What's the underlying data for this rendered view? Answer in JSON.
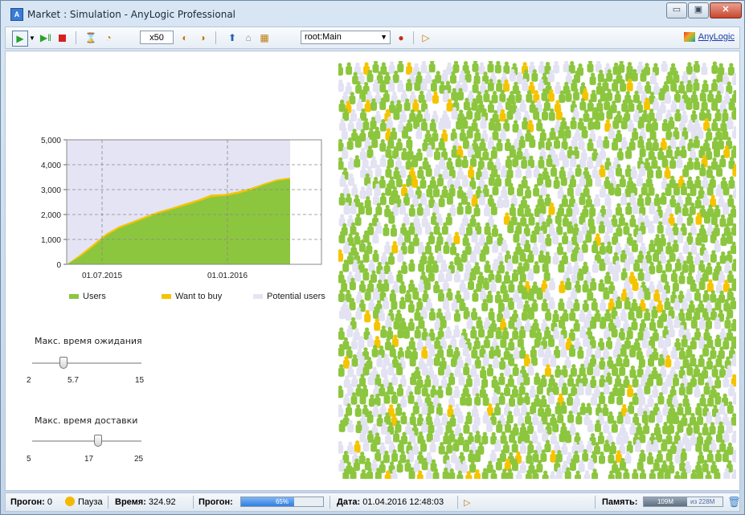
{
  "window": {
    "title": "Market : Simulation - AnyLogic Professional",
    "app_icon": "A",
    "controls": [
      "▭",
      "▣",
      "✕"
    ]
  },
  "toolbar": {
    "speed": "x50",
    "view_select": "root:Main",
    "brand": "AnyLogic"
  },
  "chart_data": {
    "type": "area",
    "x_ticks": [
      "01.07.2015",
      "01.01.2016"
    ],
    "y_ticks": [
      "5,000",
      "4,000",
      "3,000",
      "2,000",
      "1,000",
      "0"
    ],
    "ylim": [
      0,
      5000
    ],
    "grid": true,
    "legend_placement": "bottom",
    "series": [
      {
        "name": "Users",
        "color": "#8cc63f",
        "values": [
          0,
          300,
          700,
          1150,
          1450,
          1650,
          1850,
          2050,
          2200,
          2350,
          2520,
          2700,
          2740,
          2830,
          2980,
          3180,
          3350,
          3420
        ]
      },
      {
        "name": "Want to buy",
        "color": "#f5c400",
        "values": [
          0,
          380,
          800,
          1230,
          1530,
          1720,
          1930,
          2120,
          2270,
          2440,
          2600,
          2800,
          2820,
          2920,
          3060,
          3240,
          3410,
          3480
        ]
      },
      {
        "name": "Potential users",
        "color": "#e4e4f4",
        "values": [
          5000,
          5000,
          5000,
          5000,
          5000,
          5000,
          5000,
          5000,
          5000,
          5000,
          5000,
          5000,
          5000,
          5000,
          5000,
          5000,
          5000,
          5000
        ]
      }
    ]
  },
  "sliders": [
    {
      "label": "Макс. время ожидания",
      "min": "2",
      "value": "5.7",
      "max": "15",
      "fraction": 0.285
    },
    {
      "label": "Макс. время доставки",
      "min": "5",
      "value": "17",
      "max": "25",
      "fraction": 0.6
    }
  ],
  "agents": {
    "colors": {
      "user": "#8cc63f",
      "want": "#f5c400",
      "potential": "#e2e2f2"
    }
  },
  "status": {
    "run_label": "Прогон:",
    "run_value": "0",
    "pause_label": "Пауза",
    "time_label": "Время:",
    "time_value": "324.92",
    "progress_label": "Прогон:",
    "progress_text": "65%",
    "progress_fraction": 0.65,
    "date_label": "Дата:",
    "date_value": "01.04.2016 12:48:03",
    "memory_label": "Память:",
    "memory_used": "109M",
    "memory_total": "из 228M"
  }
}
